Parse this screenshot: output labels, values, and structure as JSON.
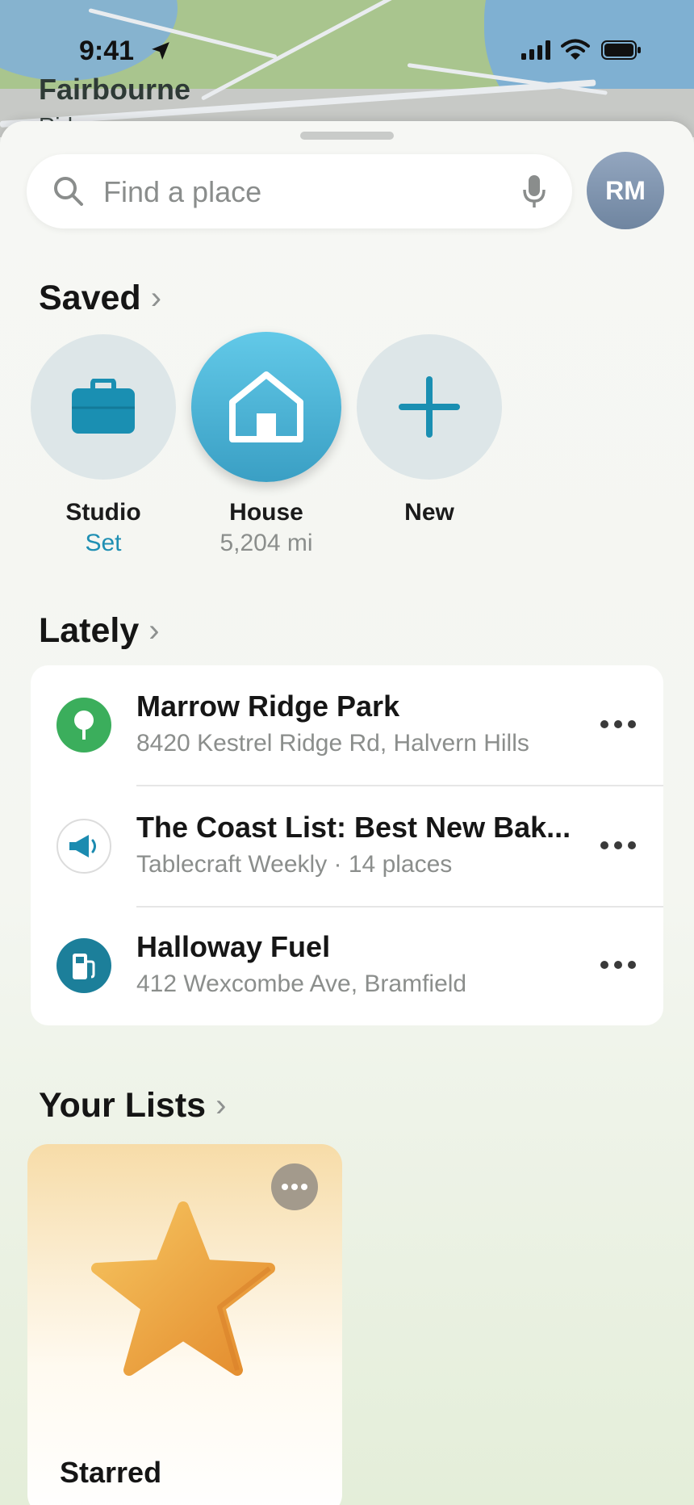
{
  "status_bar": {
    "time": "9:41"
  },
  "map": {
    "place_label": "Fairbourne",
    "place_label_partial": "Rid"
  },
  "search": {
    "placeholder": "Find a place",
    "avatar_initials": "RM"
  },
  "saved": {
    "heading": "Saved",
    "items": [
      {
        "label": "Studio",
        "sub": "Set",
        "sub_color": "#1f8fb3",
        "icon": "briefcase-icon"
      },
      {
        "label": "House",
        "sub": "5,204 mi",
        "sub_color": "#8b8e8c",
        "icon": "house-icon"
      },
      {
        "label": "New",
        "sub": "",
        "icon": "plus-icon"
      }
    ]
  },
  "lately": {
    "heading": "Lately",
    "items": [
      {
        "title": "Marrow Ridge Park",
        "subtitle": "8420 Kestrel Ridge Rd, Halvern Hills",
        "icon": "tree-icon",
        "color": "#3bae5c"
      },
      {
        "title": "The Coast List: Best New Bak...",
        "subtitle": "Tablecraft Weekly · 14 places",
        "icon": "megaphone-icon",
        "color": "#1b8bb0"
      },
      {
        "title": "Halloway Fuel",
        "subtitle": "412 Wexcombe Ave, Bramfield",
        "icon": "fuel-pump-icon",
        "color": "#1c7f9a"
      }
    ]
  },
  "lists": {
    "heading": "Your Lists",
    "items": [
      {
        "name": "Starred",
        "icon": "star-icon"
      }
    ]
  }
}
